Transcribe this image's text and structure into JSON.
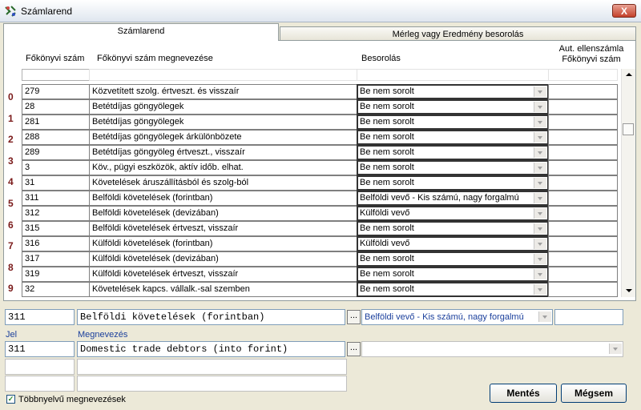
{
  "window": {
    "title": "Számlarend",
    "close_label": "X"
  },
  "tabs": [
    {
      "label": "Számlarend",
      "active": true
    },
    {
      "label": "Mérleg vagy Eredmény besorolás",
      "active": false
    }
  ],
  "grid": {
    "headers": {
      "code": "Főkönyvi szám",
      "name": "Főkönyvi szám megnevezése",
      "class": "Besorolás",
      "auto": "Aut. ellenszámla Főkönyvi szám"
    },
    "row_numbers": [
      "0",
      "1",
      "2",
      "3",
      "4",
      "5",
      "6",
      "7",
      "8",
      "9"
    ],
    "rows": [
      {
        "code": "279",
        "name": "Közvetített szolg. értveszt. és visszaír",
        "class": "Be nem sorolt",
        "auto": ""
      },
      {
        "code": "28",
        "name": "Betétdíjas göngyölegek",
        "class": "Be nem sorolt",
        "auto": ""
      },
      {
        "code": "281",
        "name": "Betétdíjas göngyölegek",
        "class": "Be nem sorolt",
        "auto": ""
      },
      {
        "code": "288",
        "name": "Betétdíjas göngyölegek árkülönbözete",
        "class": "Be nem sorolt",
        "auto": ""
      },
      {
        "code": "289",
        "name": "Betétdíjas göngyöleg értveszt., visszaír",
        "class": "Be nem sorolt",
        "auto": ""
      },
      {
        "code": "3",
        "name": "Köv., pügyi eszközök, aktív időb. elhat.",
        "class": "Be nem sorolt",
        "auto": ""
      },
      {
        "code": "31",
        "name": "Követelések áruszállításból és szolg-ból",
        "class": "Be nem sorolt",
        "auto": ""
      },
      {
        "code": "311",
        "name": "Belföldi követelések (forintban)",
        "class": "Belföldi vevő - Kis számú, nagy forgalmú",
        "auto": ""
      },
      {
        "code": "312",
        "name": "Belföldi követelések (devizában)",
        "class": "Külföldi vevő",
        "auto": ""
      },
      {
        "code": "315",
        "name": "Belföldi követelések értveszt, visszaír",
        "class": "Be nem sorolt",
        "auto": ""
      },
      {
        "code": "316",
        "name": "Külföldi követelések (forintban)",
        "class": "Külföldi vevő",
        "auto": ""
      },
      {
        "code": "317",
        "name": "Külföldi követelések (devizában)",
        "class": "Be nem sorolt",
        "auto": ""
      },
      {
        "code": "319",
        "name": "Külföldi követelések értveszt, visszaír",
        "class": "Be nem sorolt",
        "auto": ""
      },
      {
        "code": "32",
        "name": "Követelések kapcs. vállalk.-sal szemben",
        "class": "Be nem sorolt",
        "auto": ""
      }
    ]
  },
  "editor": {
    "code": "311",
    "name": "Belföldi követelések (forintban)",
    "dots_label": "...",
    "class_value": "Belföldi vevő - Kis számú, nagy forgalmú",
    "auto_value": "",
    "jel_label": "Jel",
    "megnevezes_label": "Megnevezés",
    "jel_value": "311",
    "megnevezes_value": "Domestic trade debtors (into forint)",
    "lang_combo_value": "",
    "extra1_code": "",
    "extra1_name": "",
    "extra2_code": "",
    "extra2_name": ""
  },
  "multilang": {
    "label": "Többnyelvű megnevezések",
    "checked": true,
    "check_glyph": "✓"
  },
  "buttons": {
    "save": "Mentés",
    "cancel": "Mégsem"
  },
  "colors": {
    "accent": "#1a3f9c",
    "row_number": "#7a1a1a",
    "close": "#c4412b"
  }
}
